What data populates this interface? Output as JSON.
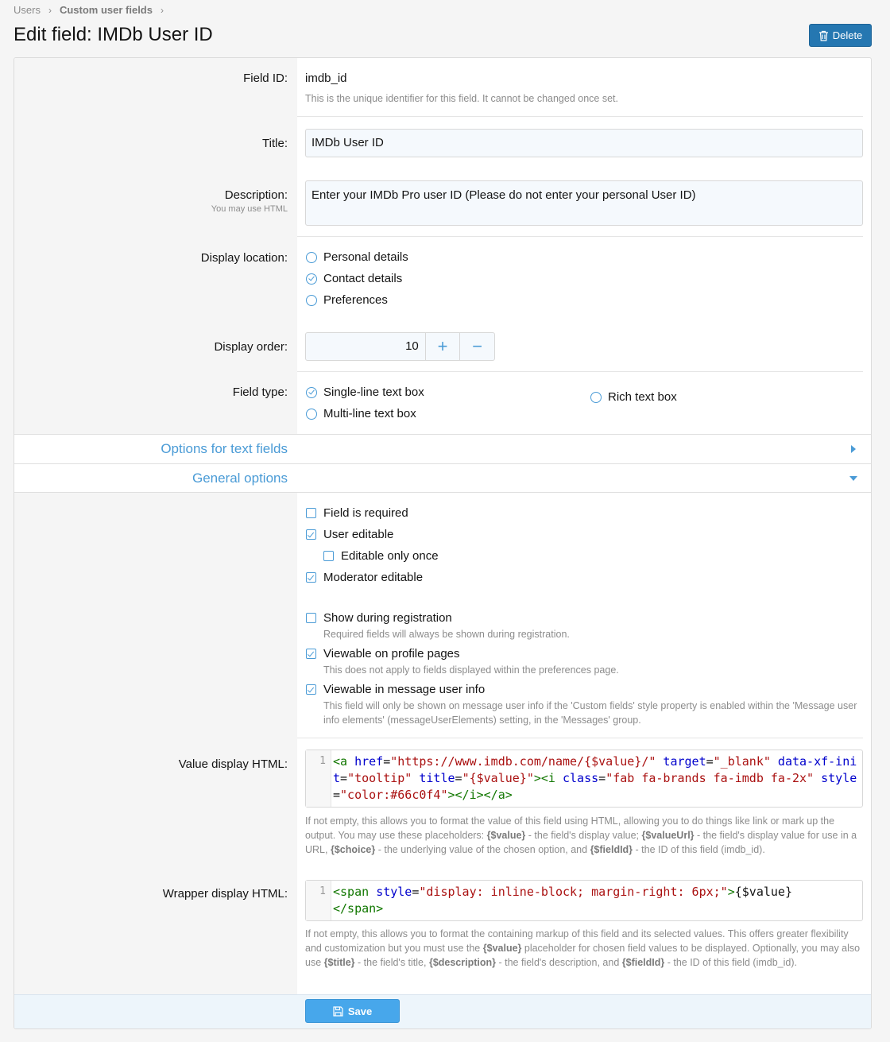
{
  "breadcrumb": {
    "items": [
      "Users",
      "Custom user fields"
    ]
  },
  "page_title": "Edit field: IMDb User ID",
  "delete_label": "Delete",
  "fields": {
    "field_id": {
      "label": "Field ID:",
      "value": "imdb_id",
      "hint": "This is the unique identifier for this field. It cannot be changed once set."
    },
    "title": {
      "label": "Title:",
      "value": "IMDb User ID"
    },
    "description": {
      "label": "Description:",
      "sublabel": "You may use HTML",
      "value": "Enter your IMDb Pro user ID (Please do not enter your personal User ID)"
    },
    "display_location": {
      "label": "Display location:",
      "options": [
        "Personal details",
        "Contact details",
        "Preferences"
      ],
      "selected": "Contact details"
    },
    "display_order": {
      "label": "Display order:",
      "value": "10"
    },
    "field_type": {
      "label": "Field type:",
      "options": [
        "Single-line text box",
        "Rich text box",
        "Multi-line text box"
      ],
      "selected": "Single-line text box"
    }
  },
  "sections": {
    "text_options": "Options for text fields",
    "general_options": "General options"
  },
  "general": {
    "field_required": {
      "label": "Field is required",
      "checked": false
    },
    "user_editable": {
      "label": "User editable",
      "checked": true
    },
    "editable_once": {
      "label": "Editable only once",
      "checked": false
    },
    "moderator_editable": {
      "label": "Moderator editable",
      "checked": true
    },
    "show_registration": {
      "label": "Show during registration",
      "checked": false,
      "hint": "Required fields will always be shown during registration."
    },
    "viewable_profile": {
      "label": "Viewable on profile pages",
      "checked": true,
      "hint": "This does not apply to fields displayed within the preferences page."
    },
    "viewable_message": {
      "label": "Viewable in message user info",
      "checked": true,
      "hint": "This field will only be shown on message user info if the 'Custom fields' style property is enabled within the 'Message user info elements' (messageUserElements) setting, in the 'Messages' group."
    }
  },
  "value_html": {
    "label": "Value display HTML:",
    "line_no": "1",
    "hint": "If not empty, this allows you to format the value of this field using HTML, allowing you to do things like link or mark up the output. You may use these placeholders: {$value} - the field's display value; {$valueUrl} - the field's display value for use in a URL, {$choice} - the underlying value of the chosen option, and {$fieldId} - the ID of this field (imdb_id).",
    "tokens": [
      {
        "c": "tg",
        "t": "<a "
      },
      {
        "c": "at",
        "t": "href"
      },
      {
        "c": "tx",
        "t": "="
      },
      {
        "c": "st",
        "t": "\"https://www.imdb.com/name/{$value}/\""
      },
      {
        "c": "tx",
        "t": " "
      },
      {
        "c": "at",
        "t": "target"
      },
      {
        "c": "tx",
        "t": "="
      },
      {
        "c": "st",
        "t": "\"_blank\""
      },
      {
        "c": "tx",
        "t": " "
      },
      {
        "c": "at",
        "t": "data-xf-init"
      },
      {
        "c": "tx",
        "t": "="
      },
      {
        "c": "st",
        "t": "\"tooltip\""
      },
      {
        "c": "tx",
        "t": " "
      },
      {
        "c": "at",
        "t": "title"
      },
      {
        "c": "tx",
        "t": "="
      },
      {
        "c": "st",
        "t": "\"{$value}\""
      },
      {
        "c": "tg",
        "t": "><i "
      },
      {
        "c": "at",
        "t": "class"
      },
      {
        "c": "tx",
        "t": "="
      },
      {
        "c": "st",
        "t": "\"fab fa-brands fa-imdb fa-2x\""
      },
      {
        "c": "tx",
        "t": " "
      },
      {
        "c": "at",
        "t": "style"
      },
      {
        "c": "tx",
        "t": "="
      },
      {
        "c": "st",
        "t": "\"color:#66c0f4\""
      },
      {
        "c": "tg",
        "t": "></i></a>"
      }
    ]
  },
  "wrapper_html": {
    "label": "Wrapper display HTML:",
    "line_no": "1",
    "hint": "If not empty, this allows you to format the containing markup of this field and its selected values. This offers greater flexibility and customization but you must use the {$value} placeholder for chosen field values to be displayed. Optionally, you may also use {$title} - the field's title, {$description} - the field's description, and {$fieldId} - the ID of this field (imdb_id).",
    "tokens": [
      {
        "c": "tg",
        "t": "<span "
      },
      {
        "c": "at",
        "t": "style"
      },
      {
        "c": "tx",
        "t": "="
      },
      {
        "c": "st",
        "t": "\"display: inline-block; margin-right: 6px;\""
      },
      {
        "c": "tg",
        "t": ">"
      },
      {
        "c": "tx",
        "t": "{$value}"
      },
      {
        "c": "tg",
        "t": "\n</span>"
      }
    ]
  },
  "save_label": "Save",
  "colors": {
    "accent": "#4a9bd6",
    "delete_button": "#2577b1",
    "save_button": "#47a7eb"
  }
}
